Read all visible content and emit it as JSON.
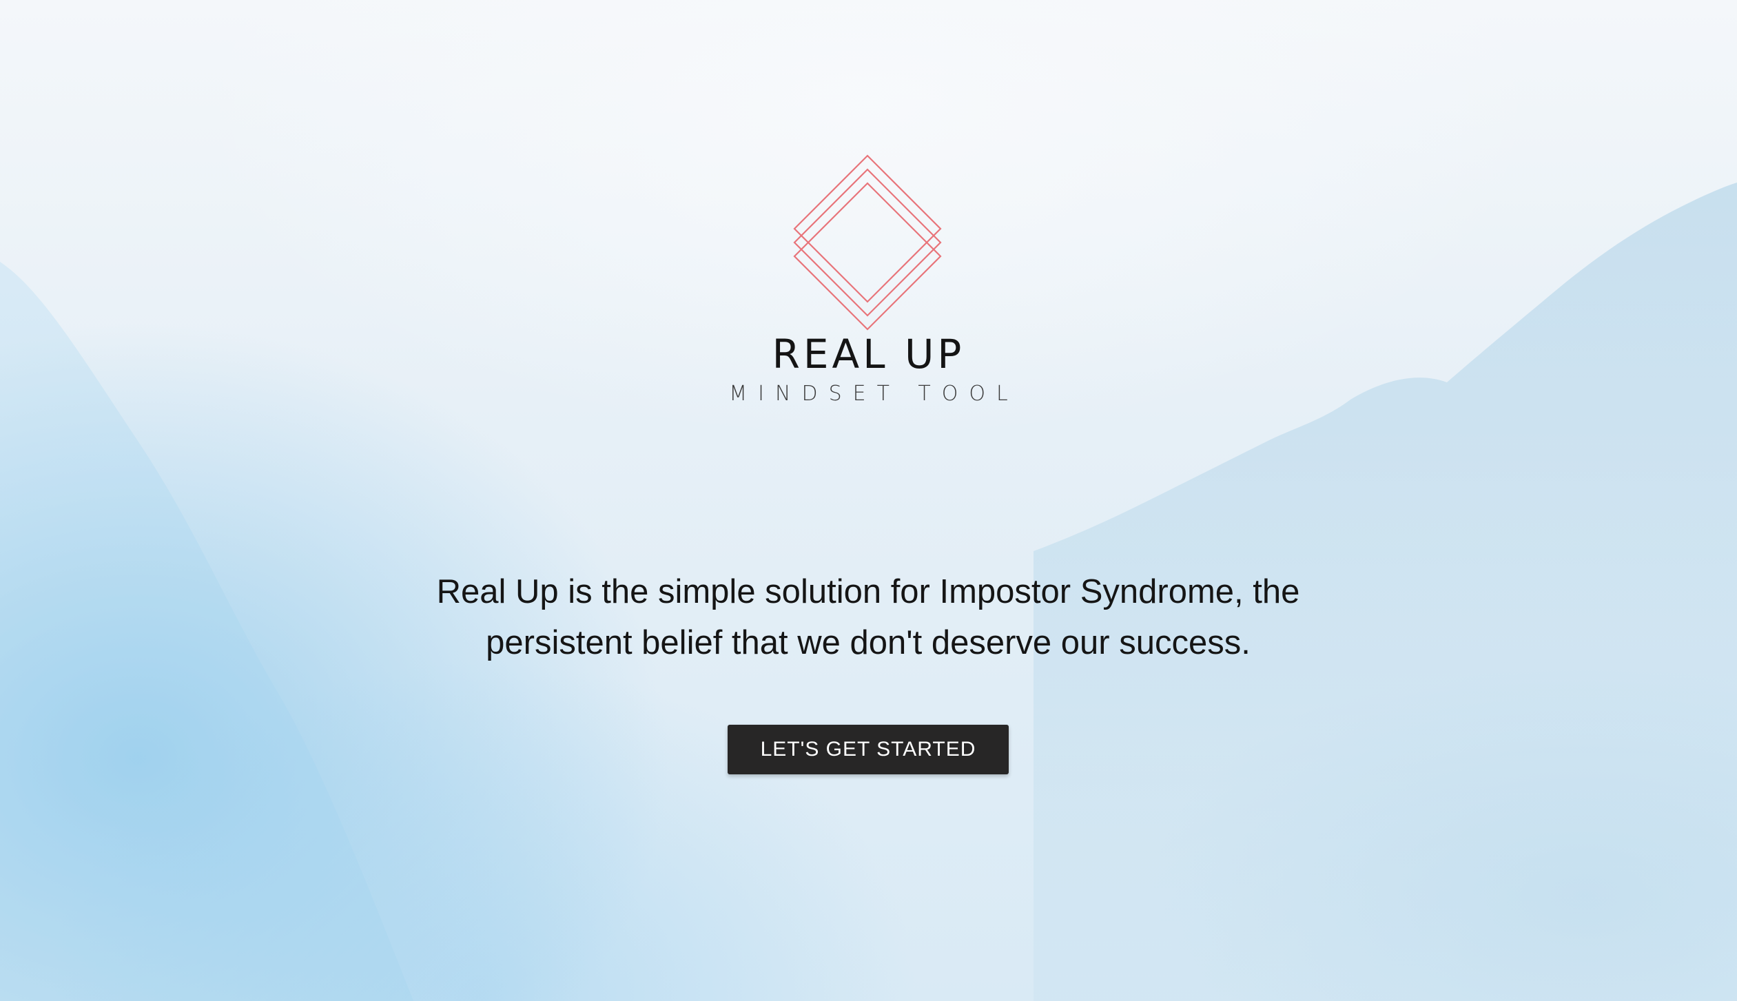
{
  "brand": {
    "logo_icon": "layered-diamond-logo",
    "title": "REAL UP",
    "subtitle": "MINDSET TOOL",
    "logo_color": "#e8747a"
  },
  "hero": {
    "tagline": "Real Up is the simple solution for Impostor Syndrome, the persistent belief that we don't deserve our success.",
    "cta_label": "LET'S GET STARTED"
  },
  "colors": {
    "button_bg": "#272626",
    "button_text": "#ffffff",
    "text": "#151515",
    "watercolor_blue": "#8cc8eb"
  }
}
